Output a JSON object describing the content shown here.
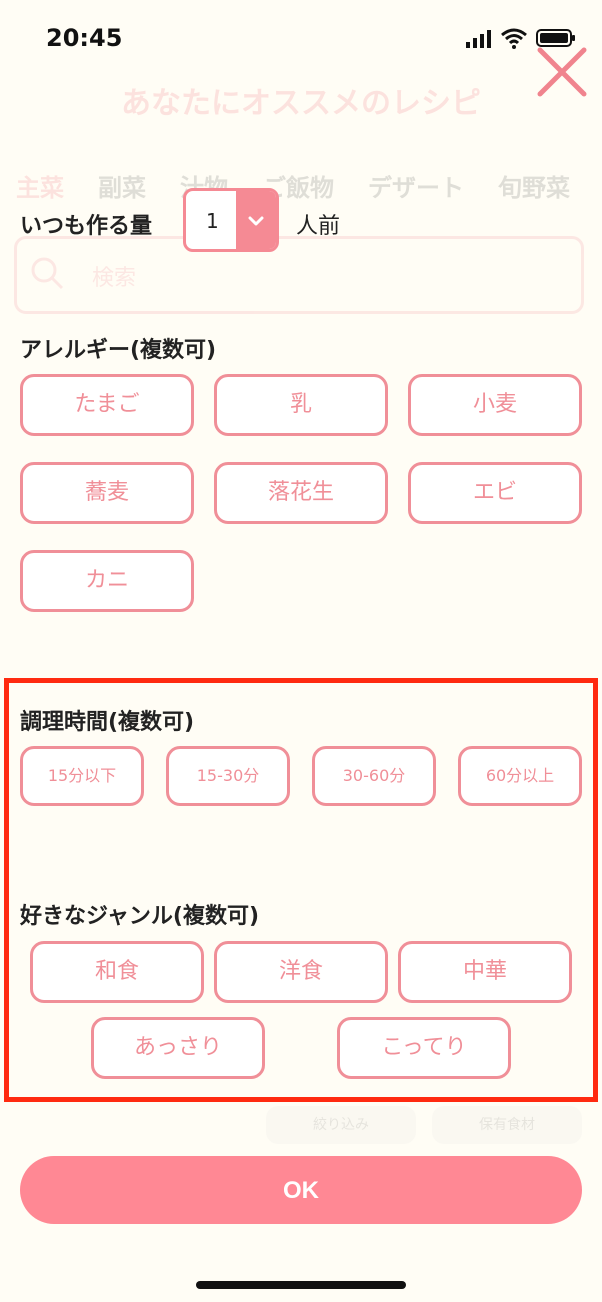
{
  "status_bar": {
    "time": "20:45"
  },
  "background": {
    "title": "あなたにオススメのレシピ",
    "tabs": [
      "主菜",
      "副菜",
      "汁物",
      "ご飯物",
      "デザート",
      "旬野菜"
    ],
    "search_placeholder": "検索",
    "buttons": [
      "絞り込み",
      "保有食材"
    ]
  },
  "amount": {
    "label": "いつも作る量",
    "value": "1",
    "unit": "人前"
  },
  "allergy": {
    "title": "アレルギー(複数可)",
    "options": [
      "たまご",
      "乳",
      "小麦",
      "蕎麦",
      "落花生",
      "エビ",
      "カニ"
    ]
  },
  "cook_time": {
    "title": "調理時間(複数可)",
    "options": [
      "15分以下",
      "15-30分",
      "30-60分",
      "60分以上"
    ]
  },
  "genre": {
    "title": "好きなジャンル(複数可)",
    "options": [
      "和食",
      "洋食",
      "中華",
      "あっさり",
      "こってり"
    ]
  },
  "ok_label": "OK",
  "colors": {
    "accent": "#f08f98",
    "ok_button": "#ff8894",
    "highlight": "#ff2a10"
  }
}
